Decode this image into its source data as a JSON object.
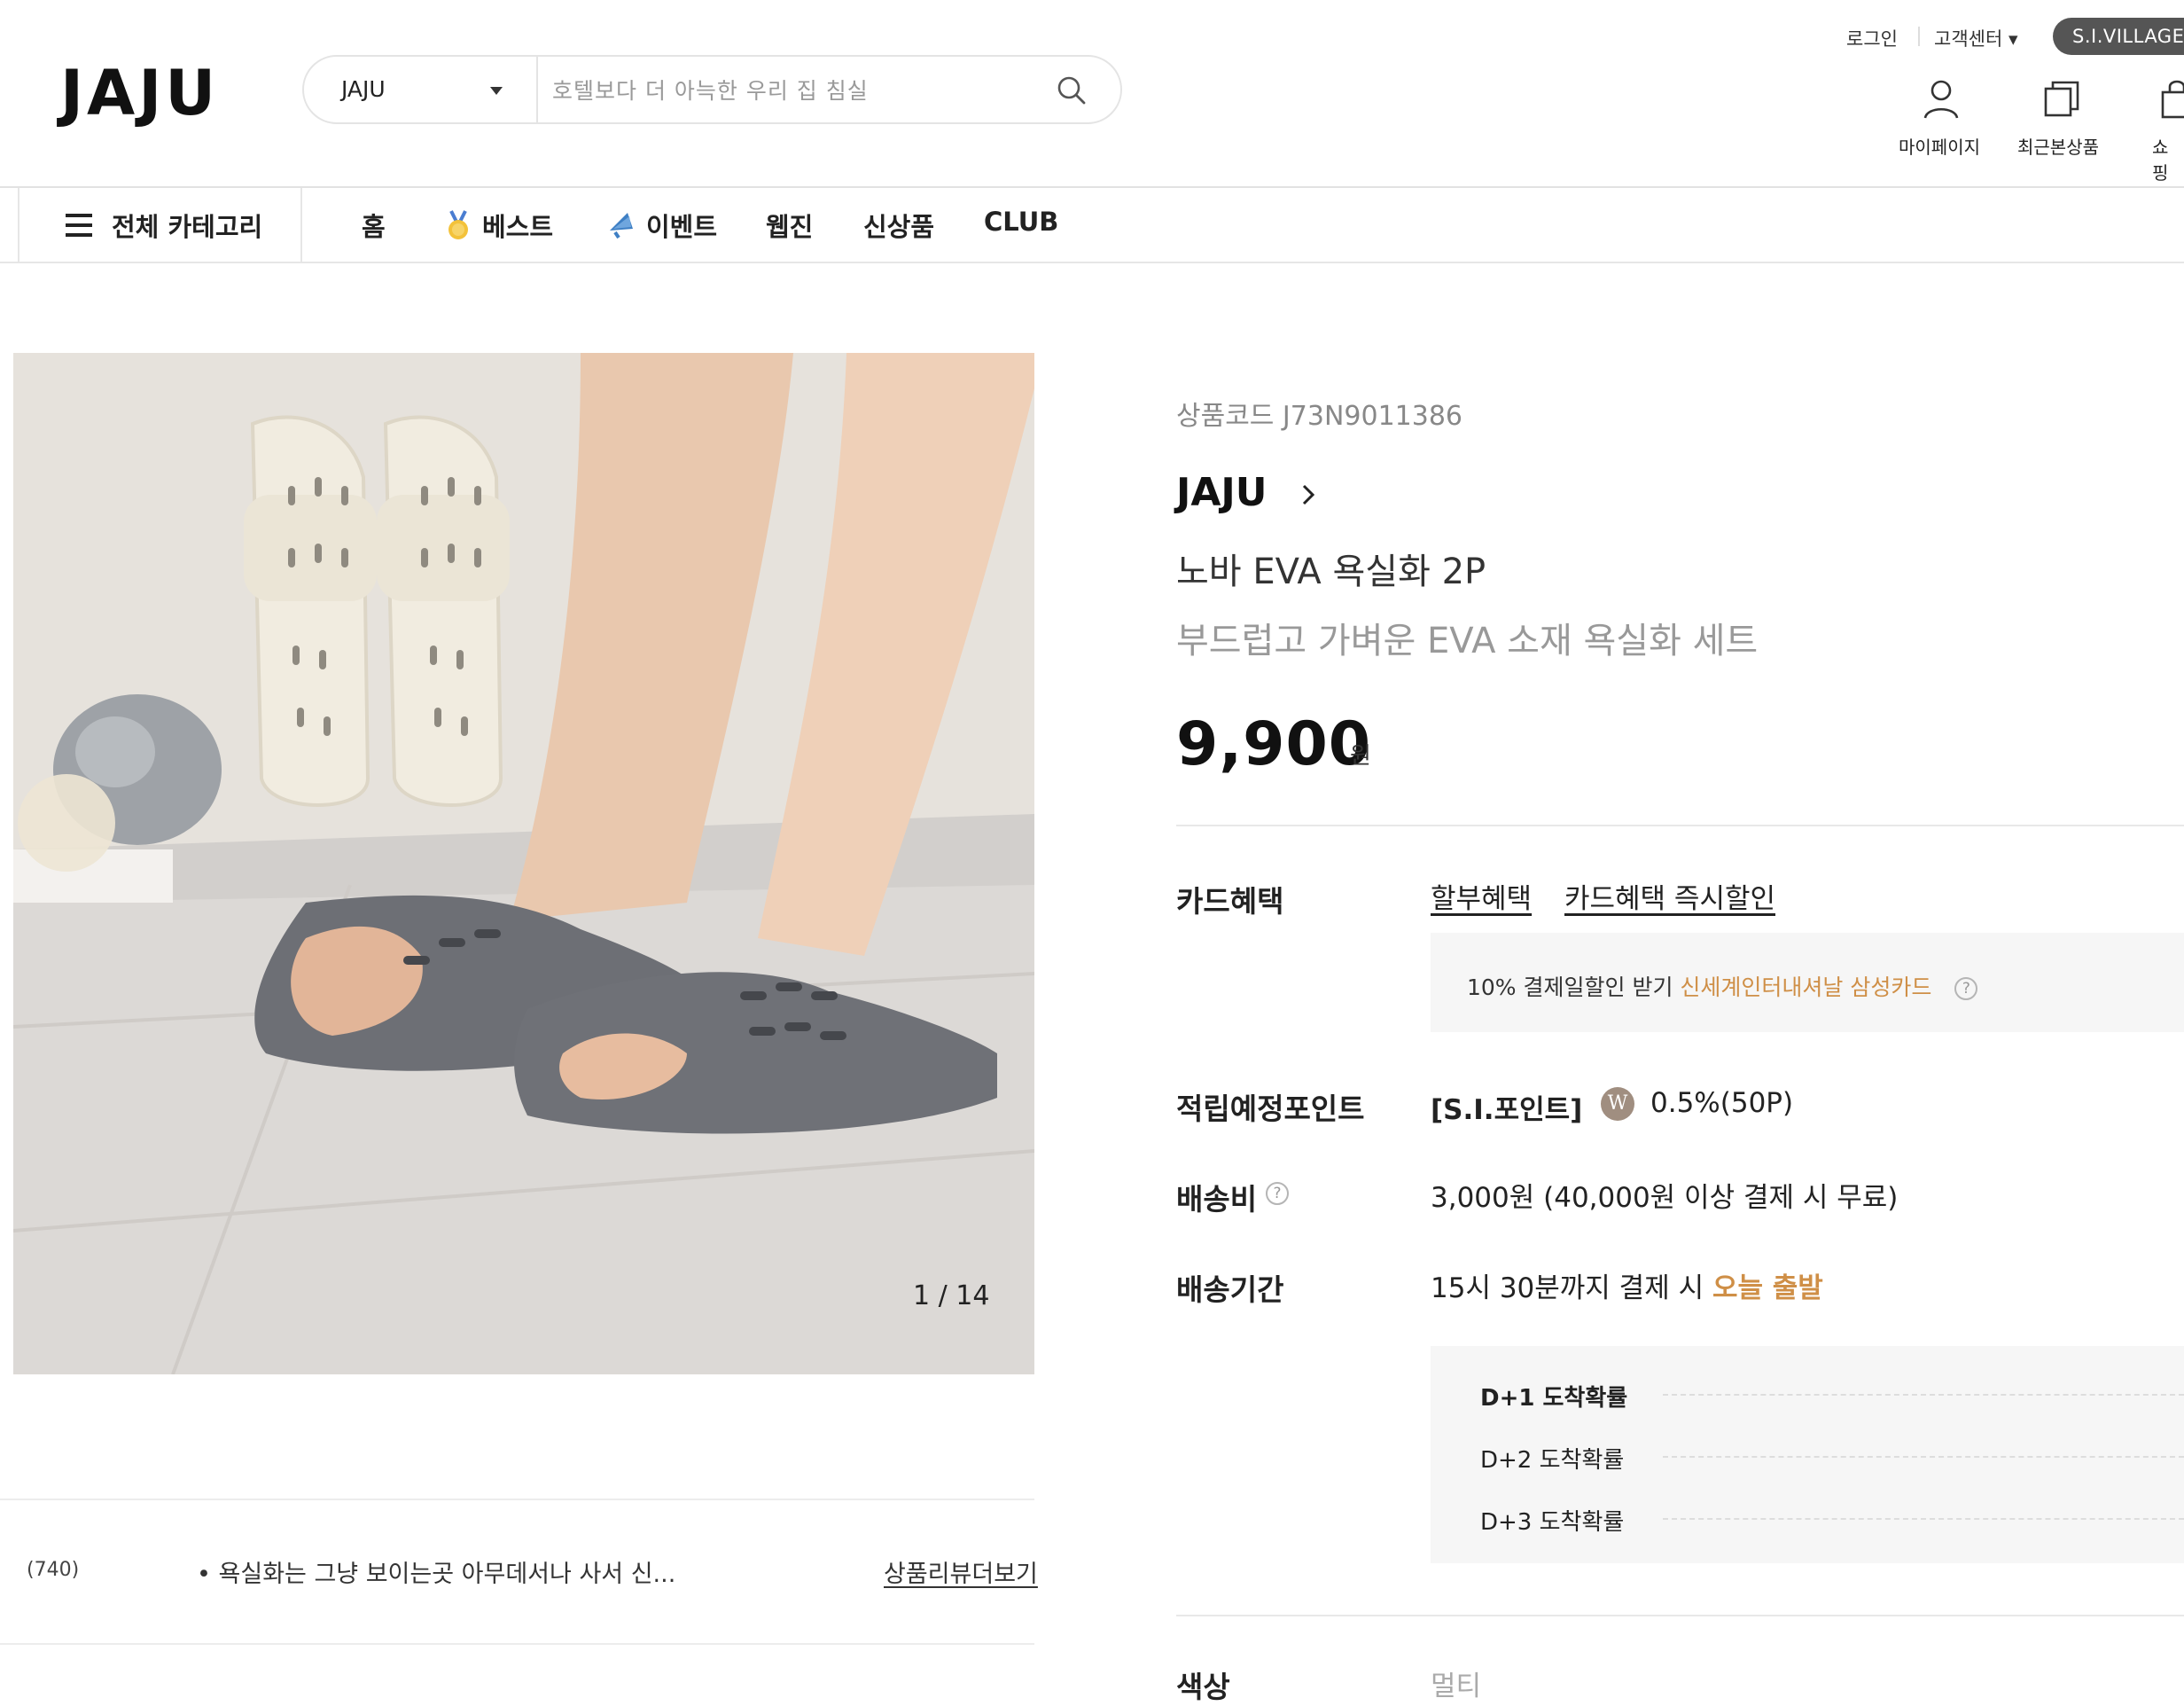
{
  "header": {
    "logo": "JAJU",
    "search": {
      "scope": "JAJU",
      "placeholder": "호텔보다 더 아늑한 우리 집 침실"
    },
    "util_links": [
      "로그인",
      "고객센터 ▾"
    ],
    "si_village": "S.I.VILLAGE",
    "icons": [
      {
        "label": "마이페이지",
        "icon": "user-icon"
      },
      {
        "label": "최근본상품",
        "icon": "recent-items-icon"
      },
      {
        "label": "쇼핑",
        "icon": "shopping-bag-icon"
      }
    ]
  },
  "nav": {
    "all_category": "전체 카테고리",
    "items": [
      "홈",
      "베스트",
      "이벤트",
      "웹진",
      "신상품",
      "CLUB"
    ]
  },
  "product": {
    "image_counter": "1 / 14",
    "code_label": "상품코드 J73N9011386",
    "brand": "JAJU",
    "name": "노바 EVA 욕실화 2P",
    "subtitle": "부드럽고 가벼운 EVA 소재 욕실화 세트",
    "price": "9,900",
    "currency": "원",
    "card_benefit": {
      "label": "카드혜택",
      "links": [
        "할부혜택",
        "카드혜택 즉시할인"
      ],
      "promo_prefix": "10% 결제일할인 받기 ",
      "promo_card": "신세계인터내셔날 삼성카드"
    },
    "points": {
      "label": "적립예정포인트",
      "type": "[S.I.포인트]",
      "badge": "W",
      "value": "0.5%(50P)"
    },
    "shipping_fee": {
      "label": "배송비",
      "value": "3,000원 (40,000원 이상 결제 시 무료)"
    },
    "delivery": {
      "label": "배송기간",
      "prefix": "15시 30분까지 결제 시 ",
      "highlight": "오늘 출발",
      "rows": [
        "D+1 도착확률",
        "D+2 도착확률",
        "D+3 도착확률"
      ]
    },
    "color_label": "색상",
    "color_value": "멀티"
  },
  "review": {
    "count": "(740)",
    "snippet": "• 욕실화는 그냥 보이는곳 아무데서나 사서 신...",
    "more_link": "상품리뷰더보기"
  },
  "colors": {
    "accent_orange": "#cf8f47",
    "badge_dark": "#555555"
  }
}
